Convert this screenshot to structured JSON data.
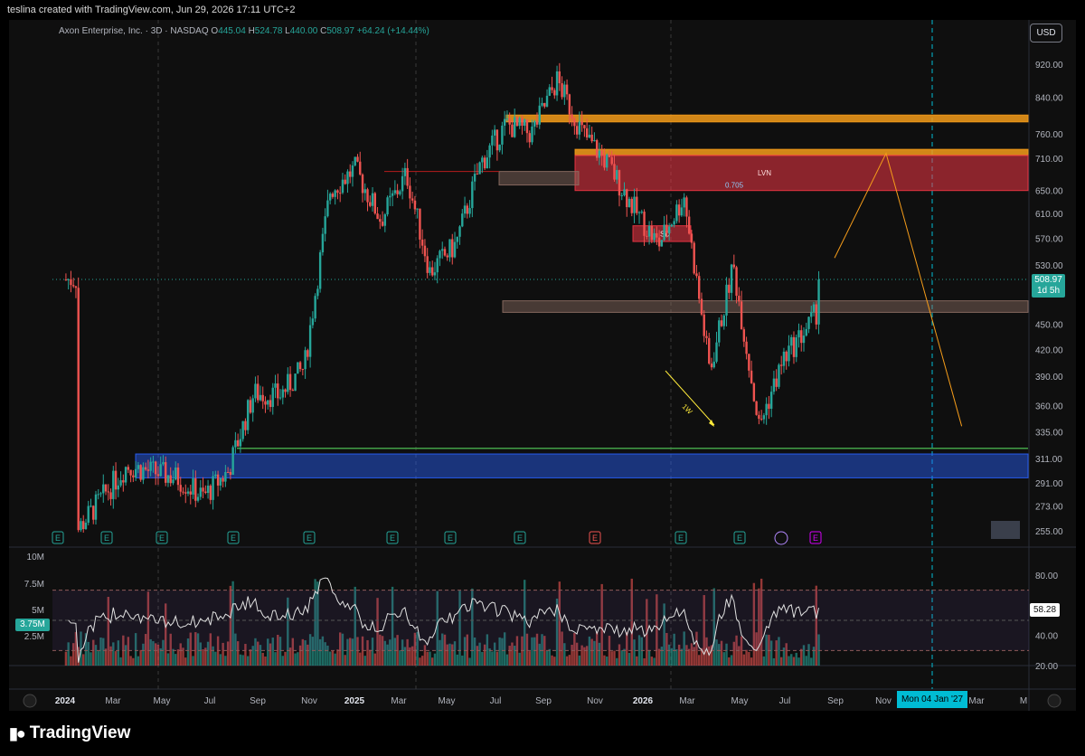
{
  "credit": "teslina created with TradingView.com, Jun 29, 2026 17:11 UTC+2",
  "legend": {
    "name": "Axon Enterprise, Inc. · 3D · NASDAQ",
    "o_key": "O",
    "o": "445.04",
    "h_key": "H",
    "h": "524.78",
    "l_key": "L",
    "l": "440.00",
    "c_key": "C",
    "c": "508.97",
    "change": "+64.24 (+14.44%)"
  },
  "currency": "USD",
  "last_price": {
    "value": "508.97",
    "countdown": "1d 5h"
  },
  "rsi_value": "58.28",
  "volume_marker": "3.75M",
  "crosshair_date": "Mon 04 Jan '27",
  "brand": "TradingView",
  "colors": {
    "up": "#26a69a",
    "down": "#ef5350",
    "accent": "#00bcd4",
    "orange": "#f59c1a",
    "zone_red": "#f23645",
    "zone_blue": "#2962ff"
  },
  "icons": [
    "zoom-z-icon",
    "earnings-e-icon",
    "dividend-icon",
    "settings-a-icon",
    "tradingview-logo-icon"
  ],
  "chart_data": [
    {
      "type": "candlestick",
      "series_name": "Axon Enterprise, Inc.",
      "interval": "3D",
      "price_scale": "log",
      "y_ticks": [
        "920.00",
        "840.00",
        "760.00",
        "710.00",
        "650.00",
        "610.00",
        "570.00",
        "530.00",
        "450.00",
        "420.00",
        "390.00",
        "360.00",
        "335.00",
        "311.00",
        "291.00",
        "273.00",
        "255.00"
      ],
      "x_ticks": [
        "2024",
        "Mar",
        "May",
        "Jul",
        "Sep",
        "Nov",
        "2025",
        "Mar",
        "May",
        "Jul",
        "Sep",
        "Nov",
        "2026",
        "Mar",
        "May",
        "Jul",
        "Sep",
        "Nov",
        "Mar",
        "M"
      ],
      "x_ticks_bold": [
        "2024",
        "2025",
        "2026"
      ],
      "key_points": [
        {
          "date": "2024-01",
          "price": 255
        },
        {
          "date": "2024-03",
          "price": 305
        },
        {
          "date": "2024-05",
          "price": 295
        },
        {
          "date": "2024-06",
          "price": 280
        },
        {
          "date": "2024-07",
          "price": 300
        },
        {
          "date": "2024-08",
          "price": 372
        },
        {
          "date": "2024-09",
          "price": 370
        },
        {
          "date": "2024-10",
          "price": 400
        },
        {
          "date": "2024-11",
          "price": 650
        },
        {
          "date": "2024-12",
          "price": 690
        },
        {
          "date": "2025-01",
          "price": 600
        },
        {
          "date": "2025-02",
          "price": 680
        },
        {
          "date": "2025-03",
          "price": 520
        },
        {
          "date": "2025-04",
          "price": 560
        },
        {
          "date": "2025-05",
          "price": 700
        },
        {
          "date": "2025-06",
          "price": 780
        },
        {
          "date": "2025-07",
          "price": 760
        },
        {
          "date": "2025-08",
          "price": 880
        },
        {
          "date": "2025-09",
          "price": 760
        },
        {
          "date": "2025-10",
          "price": 700
        },
        {
          "date": "2025-11",
          "price": 620
        },
        {
          "date": "2025-12",
          "price": 560
        },
        {
          "date": "2026-01",
          "price": 640
        },
        {
          "date": "2026-02",
          "price": 395
        },
        {
          "date": "2026-03",
          "price": 530
        },
        {
          "date": "2026-04",
          "price": 340
        },
        {
          "date": "2026-05",
          "price": 410
        },
        {
          "date": "2026-06",
          "price": 450
        },
        {
          "date": "2026-07",
          "price": 509
        }
      ],
      "zones": [
        {
          "label": "",
          "kind": "resistance",
          "low": 785,
          "high": 800
        },
        {
          "label": "",
          "kind": "resistance",
          "low": 716,
          "high": 728
        },
        {
          "label": "LVN",
          "kind": "supply",
          "low": 650,
          "high": 716
        },
        {
          "label": "SD",
          "kind": "supply",
          "low": 565,
          "high": 590
        },
        {
          "label": "",
          "kind": "range",
          "low": 660,
          "high": 685
        },
        {
          "label": "",
          "kind": "range",
          "low": 465,
          "high": 480
        },
        {
          "label": "",
          "kind": "demand",
          "low": 295,
          "high": 315
        }
      ],
      "fib_label": "0.705",
      "annotations": [
        "1W",
        "SD",
        "LVN",
        "LVN"
      ],
      "projection_path": [
        {
          "date": "2026-07",
          "price": 540
        },
        {
          "date": "2026-09",
          "price": 720
        },
        {
          "date": "2026-12",
          "price": 340
        }
      ]
    },
    {
      "type": "bar",
      "series_name": "Volume",
      "y_ticks": [
        "10M",
        "7.5M",
        "5M",
        "2.5M"
      ],
      "last": "3.75M"
    },
    {
      "type": "line",
      "series_name": "RSI",
      "y_ticks": [
        "80.00",
        "40.00",
        "20.00"
      ],
      "band": [
        30,
        70
      ],
      "last": "58.28"
    }
  ]
}
